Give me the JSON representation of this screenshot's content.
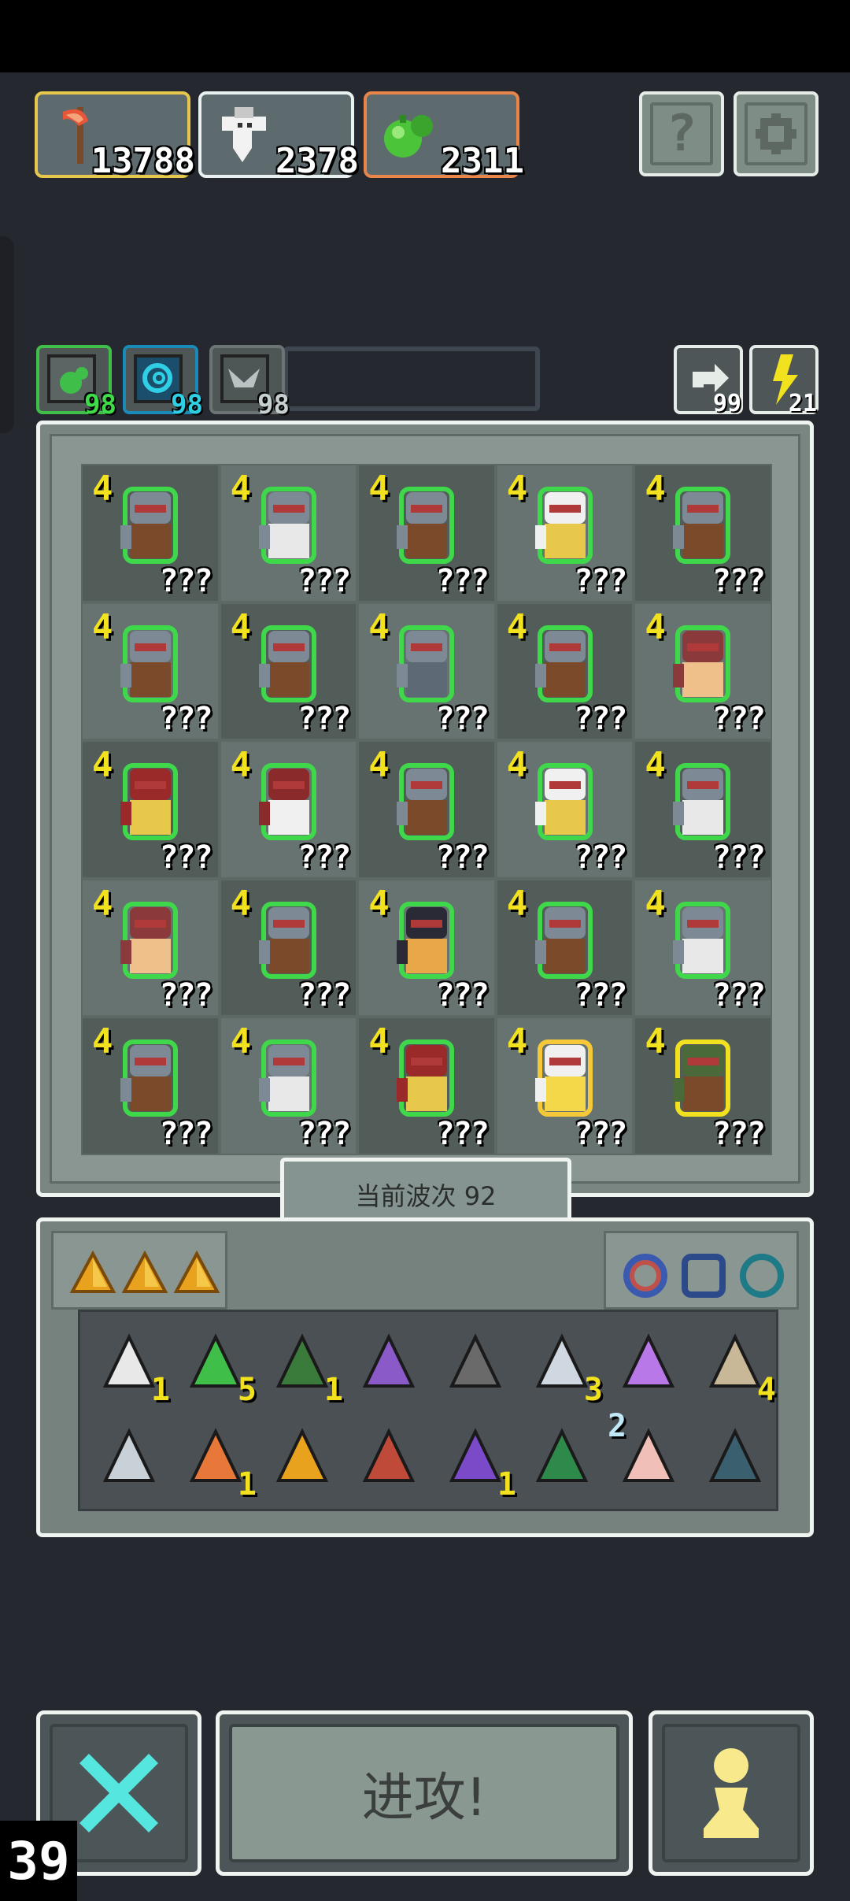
{
  "resources": [
    {
      "value": "13788",
      "icon": "axe-icon",
      "color": "#e5c84c"
    },
    {
      "value": "2378",
      "icon": "ghost-icon",
      "color": "#e8f0f0"
    },
    {
      "value": "2311",
      "icon": "green-potion-icon",
      "color": "#e8854a"
    }
  ],
  "top_buttons": {
    "help": "?",
    "settings": "gear-icon"
  },
  "slots": [
    {
      "value": "98",
      "icon": "green-gem-icon",
      "color": "#3fbf4a",
      "num_color": "#3fdc4a"
    },
    {
      "value": "98",
      "icon": "spiral-icon",
      "color": "#1a8ab8",
      "num_color": "#2fd0e6"
    },
    {
      "value": "98",
      "icon": "bird-icon",
      "color": "#6c7474",
      "num_color": "#c7d0d0"
    }
  ],
  "side_buttons": [
    {
      "icon": "refresh-icon",
      "value": "99"
    },
    {
      "icon": "lightning-icon",
      "value": "21"
    }
  ],
  "board": {
    "cells": [
      {
        "level": "4",
        "label": "???",
        "hero": "knight-shield"
      },
      {
        "level": "4",
        "label": "???",
        "hero": "knight-bearded"
      },
      {
        "level": "4",
        "label": "???",
        "hero": "knight-shield"
      },
      {
        "level": "4",
        "label": "???",
        "hero": "priest-staff"
      },
      {
        "level": "4",
        "label": "???",
        "hero": "knight-shield"
      },
      {
        "level": "4",
        "label": "???",
        "hero": "knight-shield"
      },
      {
        "level": "4",
        "label": "???",
        "hero": "knight-tower-shield"
      },
      {
        "level": "4",
        "label": "???",
        "hero": "knight-helmet"
      },
      {
        "level": "4",
        "label": "???",
        "hero": "knight-shield"
      },
      {
        "level": "4",
        "label": "???",
        "hero": "bandit"
      },
      {
        "level": "4",
        "label": "???",
        "hero": "warrior-red"
      },
      {
        "level": "4",
        "label": "???",
        "hero": "mage-red"
      },
      {
        "level": "4",
        "label": "???",
        "hero": "knight-shield"
      },
      {
        "level": "4",
        "label": "???",
        "hero": "priest-staff"
      },
      {
        "level": "4",
        "label": "???",
        "hero": "knight-bearded"
      },
      {
        "level": "4",
        "label": "???",
        "hero": "bandit"
      },
      {
        "level": "4",
        "label": "???",
        "hero": "knight-shield"
      },
      {
        "level": "4",
        "label": "???",
        "hero": "pirate"
      },
      {
        "level": "4",
        "label": "???",
        "hero": "knight-shield"
      },
      {
        "level": "4",
        "label": "???",
        "hero": "knight-bearded"
      },
      {
        "level": "4",
        "label": "???",
        "hero": "knight-shield"
      },
      {
        "level": "4",
        "label": "???",
        "hero": "knight-bearded"
      },
      {
        "level": "4",
        "label": "???",
        "hero": "warrior-red"
      },
      {
        "level": "4",
        "label": "???",
        "hero": "angel-girl"
      },
      {
        "level": "4",
        "label": "???",
        "hero": "treant"
      }
    ]
  },
  "wave": {
    "label": "当前波次 92"
  },
  "inventory": {
    "tabs": [
      "gold-triangle-icon",
      "gold-triangle-icon",
      "gold-triangle-icon"
    ],
    "rings": [
      "blue-red-ring-icon",
      "blue-amulet-icon",
      "teal-ring-icon"
    ],
    "items": [
      {
        "icon": "scroll-skull-icon",
        "count": "1"
      },
      {
        "icon": "green-gem-icon",
        "count": "5"
      },
      {
        "icon": "hooded-figure-icon",
        "count": "1"
      },
      {
        "icon": "purple-bat-icon",
        "count": ""
      },
      {
        "icon": "dagger-icon",
        "count": ""
      },
      {
        "icon": "battle-axe-icon",
        "count": "3"
      },
      {
        "icon": "magic-key-icon",
        "count": ""
      },
      {
        "icon": "map-icon",
        "count": "4"
      },
      {
        "icon": "sword-icon",
        "count": ""
      },
      {
        "icon": "hand-axe-icon",
        "count": "1"
      },
      {
        "icon": "golden-crown-icon",
        "count": ""
      },
      {
        "icon": "red-arrow-icon",
        "count": ""
      },
      {
        "icon": "potion-jar-icon",
        "count": "1"
      },
      {
        "icon": "green-spear-icon",
        "count": ""
      },
      {
        "icon": "eye-hand-icon",
        "count": "2"
      },
      {
        "icon": "dark-crown-icon",
        "count": ""
      }
    ]
  },
  "bottom": {
    "cancel": "close-icon",
    "attack": "进攻!",
    "pawn": "pawn-icon"
  },
  "fps": "39"
}
